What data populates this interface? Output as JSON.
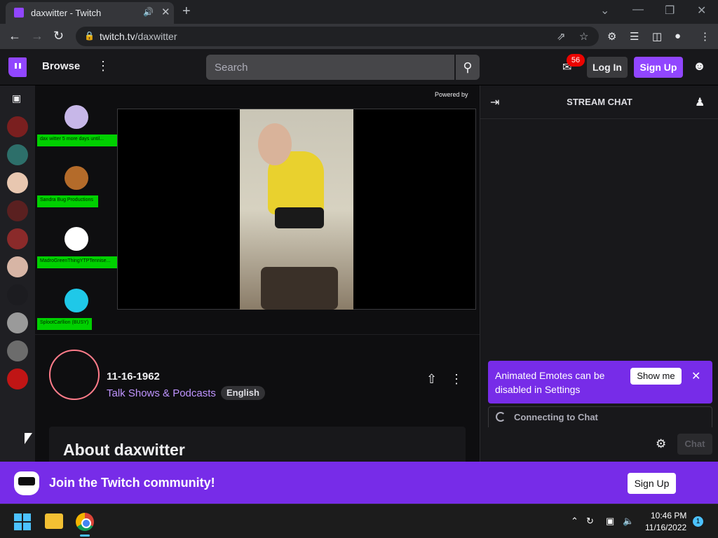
{
  "browser": {
    "tab_title": "daxwitter - Twitch",
    "url_host": "twitch.tv",
    "url_path": "/daxwitter"
  },
  "topnav": {
    "browse": "Browse",
    "search_placeholder": "Search",
    "inbox_count": "56",
    "login": "Log In",
    "signup": "Sign Up"
  },
  "player": {
    "powered_by": "Powered by",
    "channels": [
      {
        "label": "dax witter 5 more days until..."
      },
      {
        "label": "Sandra Bug Productions"
      },
      {
        "label": "MadroGreenThingYTPTennise..."
      },
      {
        "label": "SplootCarllion (BUSY)"
      }
    ]
  },
  "stream": {
    "title": "11-16-1962",
    "category": "Talk Shows & Podcasts",
    "language": "English",
    "about": "About daxwitter"
  },
  "chat": {
    "title": "STREAM CHAT",
    "notice": "Animated Emotes can be disabled in Settings",
    "show_me": "Show me",
    "connecting": "Connecting to Chat",
    "chat_button": "Chat"
  },
  "banner": {
    "text": "Join the Twitch community!",
    "signup": "Sign Up"
  },
  "taskbar": {
    "time": "10:46 PM",
    "date": "11/16/2022",
    "notifications": "1"
  },
  "colors": {
    "brand": "#9146ff",
    "banner": "#772ce8",
    "background": "#0e0e10"
  },
  "icons": [
    "twitch-logo-icon",
    "search-icon",
    "inbox-icon",
    "user-icon",
    "video-camera-icon",
    "share-icon",
    "kebab-menu-icon",
    "collapse-chat-icon",
    "community-icon",
    "settings-gear-icon",
    "close-icon"
  ]
}
